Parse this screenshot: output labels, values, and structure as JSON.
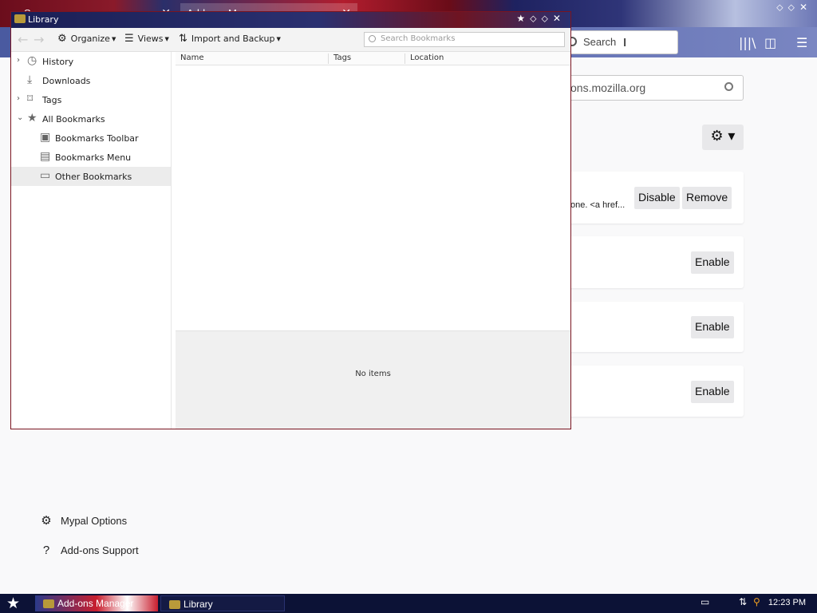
{
  "browser": {
    "tabs": [
      {
        "label": "S..."
      },
      {
        "label": "Add-ons M..."
      }
    ],
    "search_placeholder": "Search",
    "addons_search_text": "ons.mozilla.org",
    "gear_label": "⚙ ▾",
    "addons": [
      {
        "description": "one. <a href...",
        "buttons": [
          "Disable",
          "Remove"
        ]
      },
      {
        "description": "",
        "buttons": [
          "Enable"
        ]
      },
      {
        "description": "",
        "buttons": [
          "Enable"
        ]
      },
      {
        "description": "",
        "buttons": [
          "Enable"
        ]
      }
    ],
    "side_links": [
      {
        "label": "Mypal Options",
        "icon": "gear-icon"
      },
      {
        "label": "Add-ons Support",
        "icon": "help-icon"
      }
    ]
  },
  "library": {
    "title": "Library",
    "toolbar": {
      "organize": "Organize",
      "views": "Views",
      "import_backup": "Import and Backup",
      "search_placeholder": "Search Bookmarks"
    },
    "tree": [
      {
        "label": "History",
        "icon": "clock-icon",
        "expandable": true
      },
      {
        "label": "Downloads",
        "icon": "download-icon",
        "expandable": false
      },
      {
        "label": "Tags",
        "icon": "tag-icon",
        "expandable": true
      },
      {
        "label": "All Bookmarks",
        "icon": "star-icon",
        "expandable": true,
        "expanded": true
      },
      {
        "label": "Bookmarks Toolbar",
        "icon": "bookmarks-toolbar-icon",
        "indent": true
      },
      {
        "label": "Bookmarks Menu",
        "icon": "bookmarks-menu-icon",
        "indent": true
      },
      {
        "label": "Other Bookmarks",
        "icon": "folder-icon",
        "indent": true,
        "selected": true
      }
    ],
    "columns": [
      "Name",
      "Tags",
      "Location"
    ],
    "details_text": "No items"
  },
  "taskbar": {
    "tasks": [
      {
        "label": "Add-ons Manager"
      },
      {
        "label": "Library"
      }
    ],
    "clock": "12:23 PM"
  }
}
